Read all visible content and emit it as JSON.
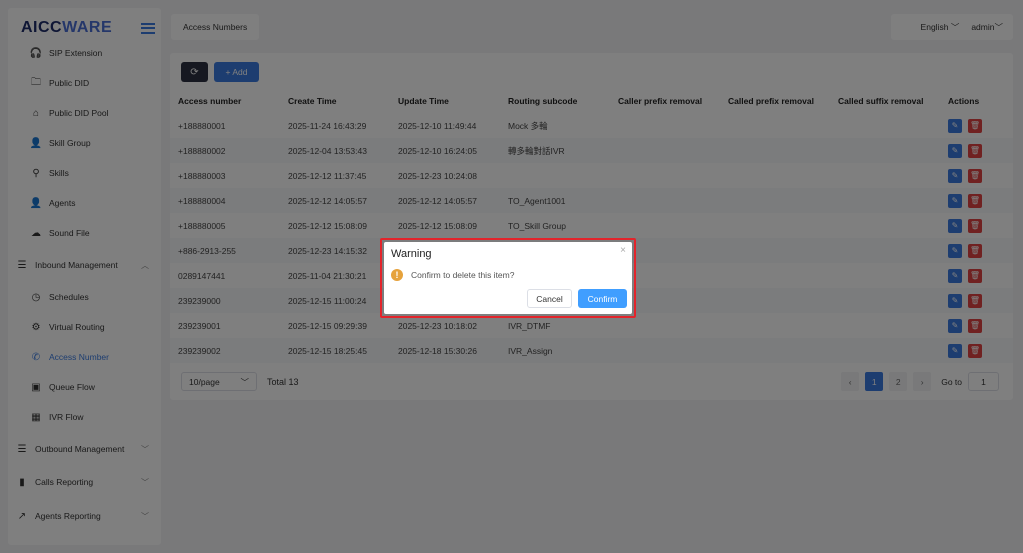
{
  "app": {
    "logo_part1": "AICC",
    "logo_part2": "WARE"
  },
  "sidebar": {
    "items": [
      {
        "label": "SIP Extension",
        "icon": "headset-icon"
      },
      {
        "label": "Public DID",
        "icon": "folder-icon"
      },
      {
        "label": "Public DID Pool",
        "icon": "home-icon"
      },
      {
        "label": "Skill Group",
        "icon": "user-group-icon"
      },
      {
        "label": "Skills",
        "icon": "user-icon"
      },
      {
        "label": "Agents",
        "icon": "person-icon"
      },
      {
        "label": "Sound File",
        "icon": "cloud-upload-icon"
      },
      {
        "label": "Inbound Management",
        "icon": "menu-icon",
        "expanded": true
      },
      {
        "label": "Schedules",
        "icon": "clock-icon"
      },
      {
        "label": "Virtual Routing",
        "icon": "gear-icon"
      },
      {
        "label": "Access Number",
        "icon": "phone-icon",
        "active": true
      },
      {
        "label": "Queue Flow",
        "icon": "queue-icon"
      },
      {
        "label": "IVR Flow",
        "icon": "grid-icon"
      },
      {
        "label": "Outbound Management",
        "icon": "menu-icon"
      },
      {
        "label": "Calls Reporting",
        "icon": "bar-chart-icon"
      },
      {
        "label": "Agents Reporting",
        "icon": "line-chart-icon"
      }
    ]
  },
  "topbar": {
    "tab_label": "Access Numbers",
    "language": "English",
    "user": "admin"
  },
  "toolbar": {
    "add_label": "+ Add"
  },
  "table": {
    "headers": [
      "Access number",
      "Create Time",
      "Update Time",
      "Routing subcode",
      "Caller prefix removal",
      "Called prefix removal",
      "Called suffix removal",
      "Actions"
    ],
    "rows": [
      [
        "+188880001",
        "2025-11-24 16:43:29",
        "2025-12-10 11:49:44",
        "Mock 多輪",
        "",
        "",
        ""
      ],
      [
        "+188880002",
        "2025-12-04 13:53:43",
        "2025-12-10 16:24:05",
        "轉多輪對話IVR",
        "",
        "",
        ""
      ],
      [
        "+188880003",
        "2025-12-12 11:37:45",
        "2025-12-23 10:24:08",
        "",
        "",
        "",
        ""
      ],
      [
        "+188880004",
        "2025-12-12 14:05:57",
        "2025-12-12 14:05:57",
        "TO_Agent1001",
        "",
        "",
        ""
      ],
      [
        "+188880005",
        "2025-12-12 15:08:09",
        "2025-12-12 15:08:09",
        "TO_Skill Group",
        "",
        "",
        ""
      ],
      [
        "+886-2913-255",
        "2025-12-23 14:15:32",
        "",
        "",
        "",
        "",
        ""
      ],
      [
        "0289147441",
        "2025-11-04 21:30:21",
        "",
        "",
        "",
        "",
        ""
      ],
      [
        "239239000",
        "2025-12-15 11:00:24",
        "",
        "",
        "",
        "",
        ""
      ],
      [
        "239239001",
        "2025-12-15 09:29:39",
        "2025-12-23 10:18:02",
        "IVR_DTMF",
        "",
        "",
        ""
      ],
      [
        "239239002",
        "2025-12-15 18:25:45",
        "2025-12-18 15:30:26",
        "IVR_Assign",
        "",
        "",
        ""
      ]
    ]
  },
  "pagination": {
    "page_size": "10/page",
    "total": "Total 13",
    "pages": [
      "1",
      "2"
    ],
    "current": "1",
    "goto_label": "Go to",
    "goto_value": "1"
  },
  "dialog": {
    "title": "Warning",
    "message": "Confirm to delete this item?",
    "cancel": "Cancel",
    "confirm": "Confirm"
  }
}
